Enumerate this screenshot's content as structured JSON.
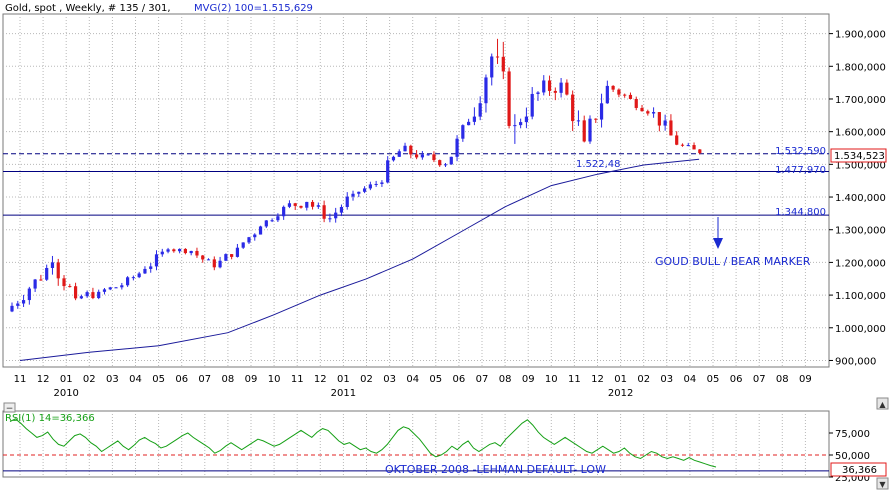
{
  "header": {
    "title": "Gold, spot , Weekly, # 135 / 301,",
    "indicator": "MVG(2) 100=1.515,629"
  },
  "colors": {
    "up": "#2a2ae6",
    "down": "#e01818",
    "ma": "#1a1a9a",
    "hline": "#000080",
    "rsi": "#16a016",
    "rsi_ref": "#e02020",
    "grid": "#b8b8b8",
    "frame": "#7a7a7a",
    "annotation": "#1a2ad0",
    "last_price_box": "#e01818"
  },
  "chart_data": [
    {
      "type": "candlestick",
      "series": [
        {
          "name": "Gold, spot"
        },
        {
          "name": "MVG(2) 100"
        }
      ],
      "yaxis": {
        "position": "right",
        "range": [
          880000,
          1960000
        ],
        "ticks": [
          {
            "value": 900000,
            "label": "900,000"
          },
          {
            "value": 1000000,
            "label": "1.000,000"
          },
          {
            "value": 1100000,
            "label": "1.100,000"
          },
          {
            "value": 1200000,
            "label": "1.200,000"
          },
          {
            "value": 1300000,
            "label": "1.300,000"
          },
          {
            "value": 1400000,
            "label": "1.400,000"
          },
          {
            "value": 1500000,
            "label": "1.500,000"
          },
          {
            "value": 1600000,
            "label": "1.600,000"
          },
          {
            "value": 1700000,
            "label": "1.700,000"
          },
          {
            "value": 1800000,
            "label": "1.800,000"
          },
          {
            "value": 1900000,
            "label": "1.900,000"
          }
        ]
      },
      "xaxis": {
        "months": [
          "11",
          "12",
          "01",
          "02",
          "03",
          "04",
          "05",
          "06",
          "07",
          "08",
          "09",
          "10",
          "11",
          "12",
          "01",
          "02",
          "03",
          "04",
          "05",
          "06",
          "07",
          "08",
          "09",
          "10",
          "11",
          "12",
          "01",
          "02",
          "03",
          "04",
          "05",
          "06",
          "07",
          "08",
          "09"
        ],
        "years": [
          {
            "label": "2010",
            "month_index": 2
          },
          {
            "label": "2011",
            "month_index": 14
          },
          {
            "label": "2012",
            "month_index": 26
          }
        ]
      },
      "grid": true,
      "horizontal_lines": [
        {
          "value": 1532590,
          "label": "1.532,590",
          "style": "dashed"
        },
        {
          "value": 1477970,
          "label": "1.477,970",
          "style": "solid"
        },
        {
          "value": 1344800,
          "label": "1.344,800",
          "style": "solid"
        }
      ],
      "ma_last": {
        "value": 1522480,
        "label": "1.522,48"
      },
      "last_price": {
        "value": 1534523,
        "label": "1.534,523"
      },
      "ma_path": [
        [
          0,
          900000
        ],
        [
          3,
          925000
        ],
        [
          6,
          945000
        ],
        [
          9,
          985000
        ],
        [
          11,
          1040000
        ],
        [
          13,
          1100000
        ],
        [
          15,
          1150000
        ],
        [
          17,
          1210000
        ],
        [
          19,
          1290000
        ],
        [
          21,
          1370000
        ],
        [
          23,
          1435000
        ],
        [
          25,
          1470000
        ],
        [
          27,
          1498000
        ],
        [
          29.4,
          1515629
        ]
      ],
      "candles_monthly": [
        [
          1050000,
          1120000,
          1020000,
          1140000
        ],
        [
          1120000,
          1200000,
          1090000,
          1230000
        ],
        [
          1200000,
          1090000,
          1070000,
          1230000
        ],
        [
          1090000,
          1110000,
          1045000,
          1140000
        ],
        [
          1110000,
          1130000,
          1080000,
          1150000
        ],
        [
          1130000,
          1180000,
          1120000,
          1195000
        ],
        [
          1180000,
          1240000,
          1165000,
          1255000
        ],
        [
          1240000,
          1235000,
          1220000,
          1265000
        ],
        [
          1235000,
          1185000,
          1160000,
          1245000
        ],
        [
          1185000,
          1245000,
          1170000,
          1260000
        ],
        [
          1245000,
          1310000,
          1240000,
          1330000
        ],
        [
          1310000,
          1370000,
          1300000,
          1380000
        ],
        [
          1370000,
          1385000,
          1330000,
          1425000
        ],
        [
          1385000,
          1335000,
          1310000,
          1415000
        ],
        [
          1335000,
          1410000,
          1320000,
          1420000
        ],
        [
          1410000,
          1440000,
          1380000,
          1450000
        ],
        [
          1440000,
          1540000,
          1430000,
          1560000
        ],
        [
          1540000,
          1530000,
          1460000,
          1580000
        ],
        [
          1530000,
          1500000,
          1490000,
          1560000
        ],
        [
          1500000,
          1630000,
          1480000,
          1640000
        ],
        [
          1630000,
          1830000,
          1620000,
          1880000
        ],
        [
          1830000,
          1620000,
          1540000,
          1920000
        ],
        [
          1620000,
          1720000,
          1600000,
          1800000
        ],
        [
          1720000,
          1750000,
          1620000,
          1800000
        ],
        [
          1750000,
          1570000,
          1540000,
          1760000
        ],
        [
          1570000,
          1740000,
          1560000,
          1760000
        ],
        [
          1740000,
          1700000,
          1690000,
          1790000
        ],
        [
          1700000,
          1660000,
          1620000,
          1720000
        ],
        [
          1660000,
          1560000,
          1540000,
          1680000
        ],
        [
          1560000,
          1534523,
          1525000,
          1600000
        ]
      ]
    },
    {
      "type": "line",
      "series": [
        {
          "name": "RSI(1) 14=36,366"
        }
      ],
      "label": "RSI(1) 14=36,366",
      "yaxis": {
        "position": "right",
        "range": [
          25000,
          100000
        ],
        "ticks": [
          {
            "value": 75000,
            "label": "75,000"
          },
          {
            "value": 50000,
            "label": "50,000"
          },
          {
            "value": 25000,
            "label": "25,000"
          }
        ]
      },
      "reference_lines": [
        {
          "value": 50000,
          "style": "dashed"
        },
        {
          "value": 32000,
          "style": "solid"
        }
      ],
      "last_value": {
        "value": 36366,
        "label": "36,366"
      },
      "values": [
        88000,
        91000,
        86000,
        80000,
        75000,
        70000,
        72000,
        76000,
        68000,
        62000,
        60000,
        66000,
        72000,
        74000,
        70000,
        64000,
        60000,
        54000,
        58000,
        62000,
        66000,
        60000,
        56000,
        61000,
        67000,
        70000,
        66000,
        63000,
        58000,
        60000,
        64000,
        68000,
        72000,
        75000,
        70000,
        66000,
        62000,
        58000,
        52000,
        55000,
        60000,
        64000,
        60000,
        56000,
        60000,
        64000,
        68000,
        66000,
        63000,
        60000,
        62000,
        66000,
        70000,
        74000,
        78000,
        74000,
        70000,
        76000,
        80000,
        78000,
        72000,
        66000,
        62000,
        64000,
        60000,
        56000,
        58000,
        54000,
        52000,
        56000,
        62000,
        70000,
        78000,
        82000,
        80000,
        74000,
        68000,
        60000,
        52000,
        48000,
        50000,
        54000,
        60000,
        56000,
        62000,
        66000,
        58000,
        54000,
        58000,
        62000,
        64000,
        60000,
        68000,
        74000,
        80000,
        86000,
        90000,
        84000,
        76000,
        70000,
        66000,
        62000,
        66000,
        70000,
        66000,
        62000,
        58000,
        54000,
        52000,
        56000,
        60000,
        56000,
        52000,
        54000,
        58000,
        52000,
        48000,
        46000,
        50000,
        54000,
        52000,
        48000,
        46000,
        48000,
        46000,
        44000,
        47000,
        44000,
        42000,
        40000,
        38000,
        36366
      ]
    }
  ],
  "annotations": {
    "bull_bear": "GOUD BULL / BEAR MARKER",
    "lehman": "OKTOBER 2008 -LEHMAN DEFAULT- LOW"
  },
  "controls": {
    "collapse_upper": "−",
    "collapse_lower": "−",
    "scroll_up": "▲",
    "scroll_down": "▼"
  }
}
